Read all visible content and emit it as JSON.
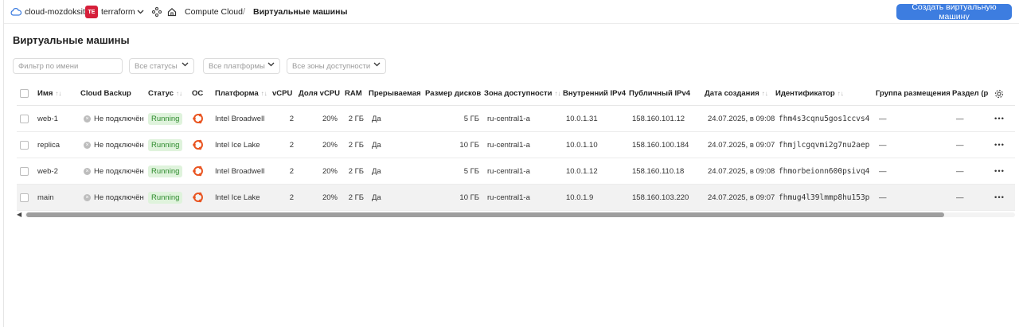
{
  "topbar": {
    "cloud_name": "cloud-mozdoksity",
    "folder_badge": "TE",
    "folder_name": "terraform",
    "breadcrumb_service": "Compute Cloud",
    "breadcrumb_sep": "/",
    "breadcrumb_current": "Виртуальные машины",
    "create_button": "Создать виртуальную машину"
  },
  "page_title": "Виртуальные машины",
  "filters": {
    "name_placeholder": "Фильтр по имени",
    "status": "Все статусы",
    "platform": "Все платформы",
    "zone": "Все зоны доступности"
  },
  "columns": {
    "name": "Имя",
    "backup": "Cloud Backup",
    "status": "Статус",
    "os": "ОС",
    "platform": "Платформа",
    "vcpu": "vCPU",
    "vcpu_share": "Доля vCPU",
    "ram": "RAM",
    "preemptible": "Прерываемая",
    "disk": "Размер дисков",
    "zone": "Зона доступности",
    "ipv4_int": "Внутренний IPv4",
    "ipv4_pub": "Публичный IPv4",
    "created": "Дата создания",
    "id": "Идентификатор",
    "placement": "Группа размещения",
    "partition": "Раздел (р"
  },
  "rows": [
    {
      "name": "web-1",
      "backup": "Не подключён",
      "status": "Running",
      "platform": "Intel Broadwell",
      "vcpu": "2",
      "vcpu_share": "20%",
      "ram": "2 ГБ",
      "preemptible": "Да",
      "disk": "5 ГБ",
      "zone": "ru-central1-a",
      "ipv4_int": "10.0.1.31",
      "ipv4_pub": "158.160.101.12",
      "created": "24.07.2025, в 09:08",
      "id": "fhm4s3cqnu5gos1ccvs4",
      "placement": "—",
      "partition": "—",
      "selected": false
    },
    {
      "name": "replica",
      "backup": "Не подключён",
      "status": "Running",
      "platform": "Intel Ice Lake",
      "vcpu": "2",
      "vcpu_share": "20%",
      "ram": "2 ГБ",
      "preemptible": "Да",
      "disk": "10 ГБ",
      "zone": "ru-central1-a",
      "ipv4_int": "10.0.1.10",
      "ipv4_pub": "158.160.100.184",
      "created": "24.07.2025, в 09:07",
      "id": "fhmjlcgqvmi2g7nu2aep",
      "placement": "—",
      "partition": "—",
      "selected": false
    },
    {
      "name": "web-2",
      "backup": "Не подключён",
      "status": "Running",
      "platform": "Intel Broadwell",
      "vcpu": "2",
      "vcpu_share": "20%",
      "ram": "2 ГБ",
      "preemptible": "Да",
      "disk": "5 ГБ",
      "zone": "ru-central1-a",
      "ipv4_int": "10.0.1.12",
      "ipv4_pub": "158.160.110.18",
      "created": "24.07.2025, в 09:08",
      "id": "fhmorbeionn600psivq4",
      "placement": "—",
      "partition": "—",
      "selected": false
    },
    {
      "name": "main",
      "backup": "Не подключён",
      "status": "Running",
      "platform": "Intel Ice Lake",
      "vcpu": "2",
      "vcpu_share": "20%",
      "ram": "2 ГБ",
      "preemptible": "Да",
      "disk": "10 ГБ",
      "zone": "ru-central1-a",
      "ipv4_int": "10.0.1.9",
      "ipv4_pub": "158.160.103.220",
      "created": "24.07.2025, в 09:07",
      "id": "fhmug4l39lmmp8hu153p",
      "placement": "—",
      "partition": "—",
      "selected": true
    }
  ],
  "colors": {
    "accent": "#3d7de0",
    "running_bg": "#dff3dc",
    "running_text": "#2e8b2e",
    "ubuntu": "#e95420",
    "folder_badge": "#d61f3a"
  },
  "icons": {
    "cloud": "cloud-icon",
    "os": "ubuntu-icon",
    "settings": "gear-icon",
    "row_menu": "more-dots-icon"
  }
}
